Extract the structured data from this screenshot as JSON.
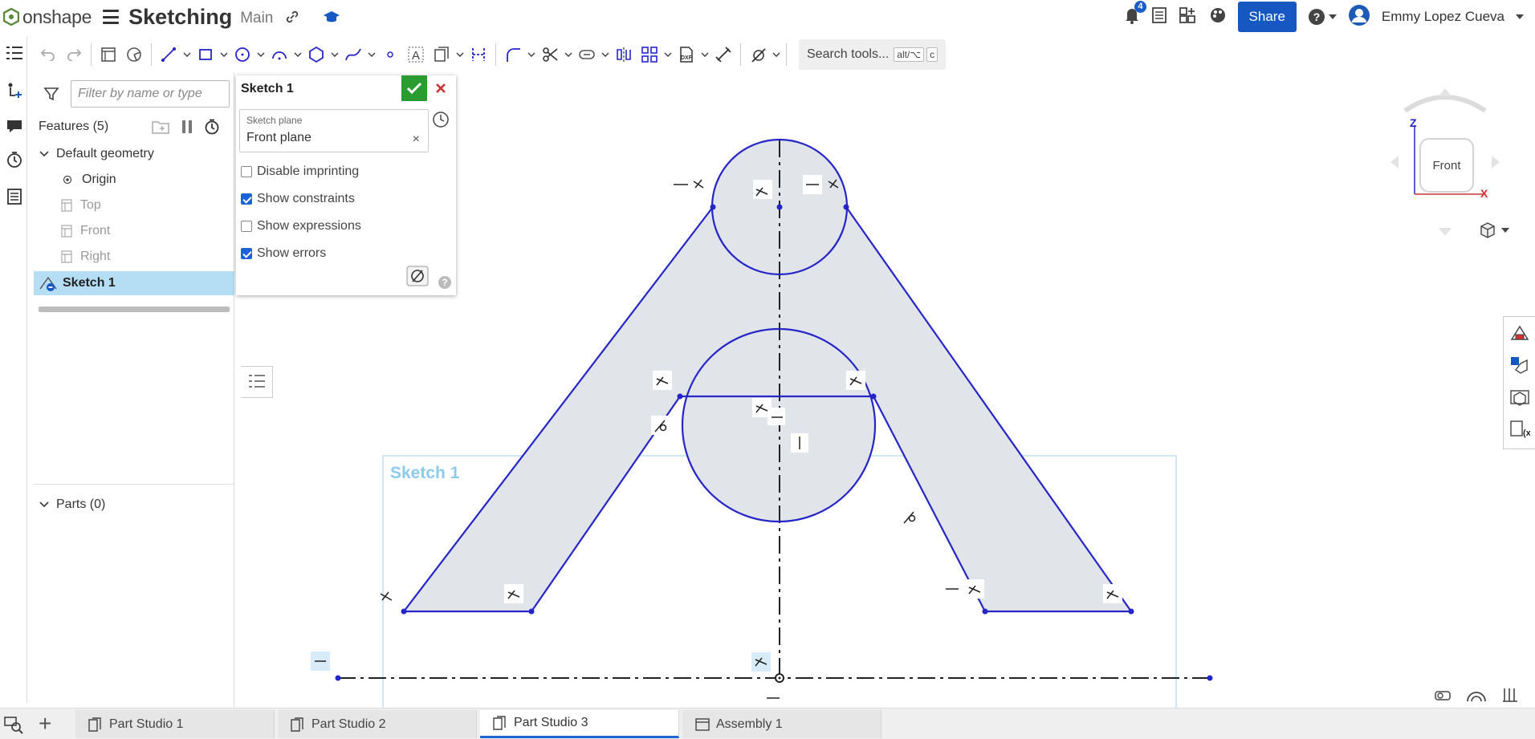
{
  "header": {
    "logo_text": "onshape",
    "doc_title": "Sketching",
    "branch": "Main",
    "notification_count": "4",
    "share_label": "Share",
    "user_name": "Emmy Lopez Cueva"
  },
  "toolbar": {
    "search_label": "Search tools...",
    "shortcut_key1": "alt/⌥",
    "shortcut_key2": "c"
  },
  "feature_panel": {
    "filter_placeholder": "Filter by name or type",
    "features_label": "Features (5)",
    "default_geometry": "Default geometry",
    "origin": "Origin",
    "top": "Top",
    "front": "Front",
    "right": "Right",
    "sketch": "Sketch 1",
    "parts_label": "Parts (0)"
  },
  "sketch_dialog": {
    "title": "Sketch 1",
    "plane_label": "Sketch plane",
    "plane_value": "Front plane",
    "plane_clear": "×",
    "disable_imprinting": "Disable imprinting",
    "show_constraints": "Show constraints",
    "show_expressions": "Show expressions",
    "show_errors": "Show errors",
    "help": "?"
  },
  "viewport": {
    "sketch_label": "Sketch 1",
    "view_cube_face": "Front",
    "axis_z": "Z",
    "axis_x": "X"
  },
  "tabs": [
    "Part Studio 1",
    "Part Studio 2",
    "Part Studio 3",
    "Assembly 1"
  ],
  "colors": {
    "sketch_line": "#2525c8",
    "sketch_fill": "#e1e4e9",
    "region_box": "#bfe1f3",
    "accent": "#1757c2",
    "confirm": "#2b9c31",
    "cancel": "#d03030"
  }
}
